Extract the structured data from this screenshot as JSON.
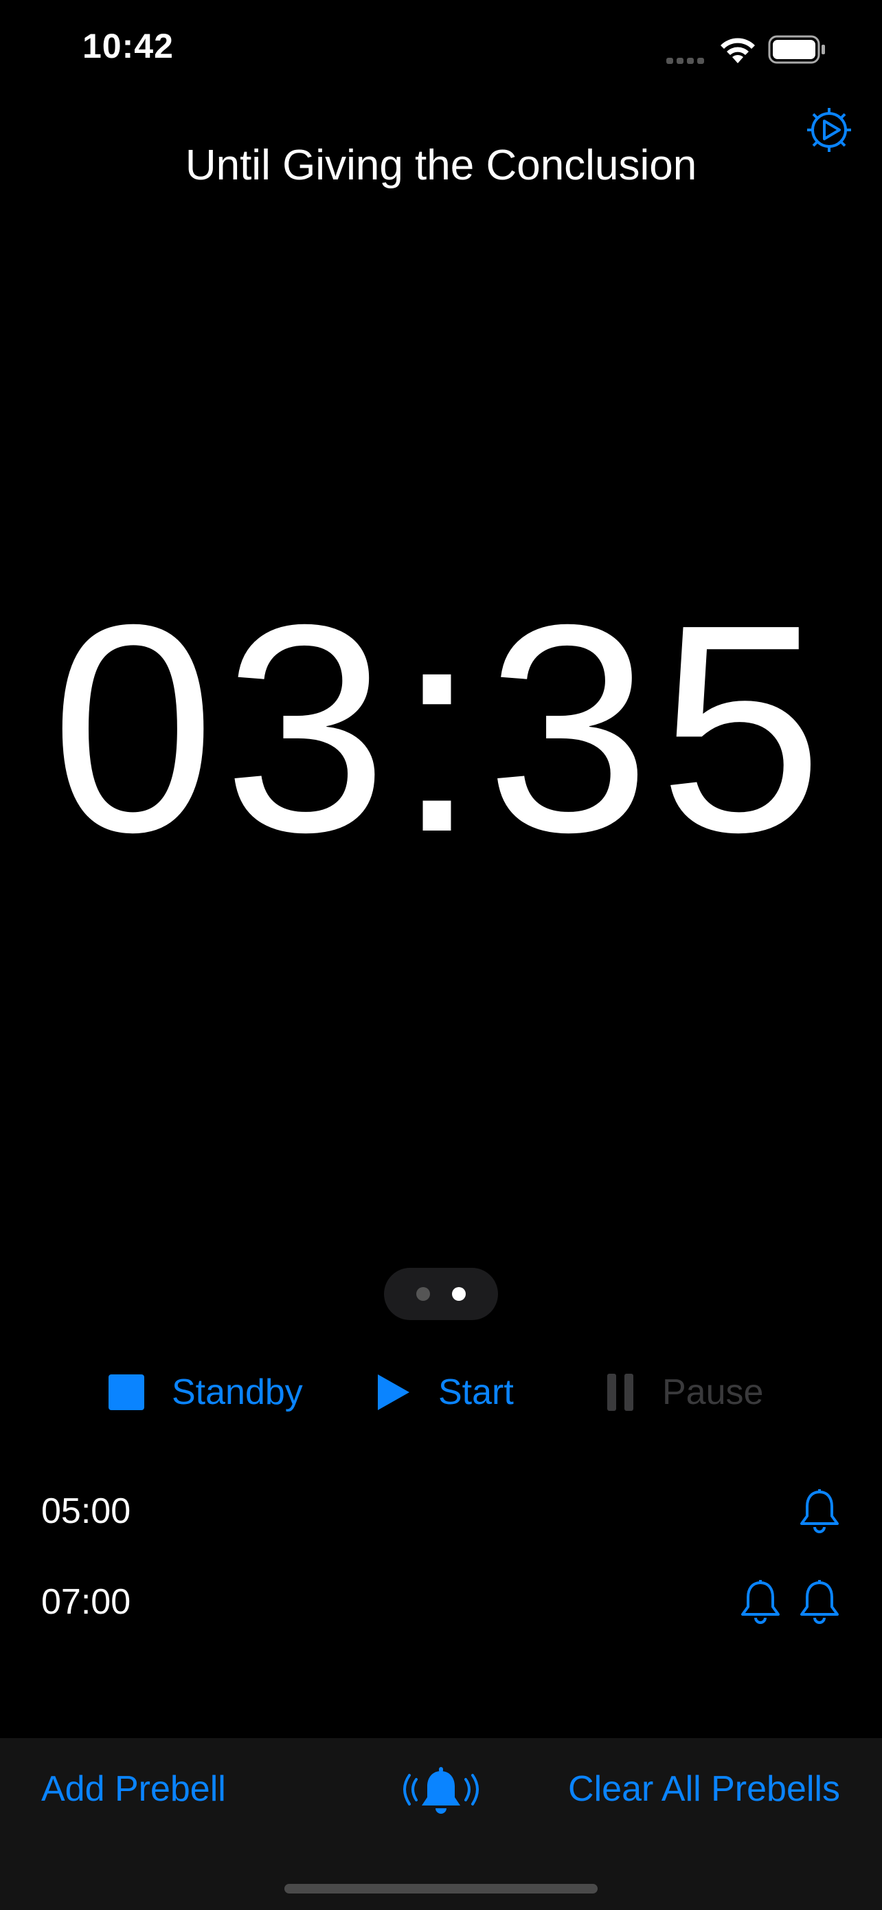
{
  "status_bar": {
    "time": "10:42"
  },
  "header": {
    "title": "Until Giving the Conclusion",
    "settings_icon": "gear-play-icon"
  },
  "timer": {
    "display": "03:35"
  },
  "page_indicator": {
    "pages": 2,
    "current": 2
  },
  "controls": {
    "standby_label": "Standby",
    "start_label": "Start",
    "pause_label": "Pause"
  },
  "prebells": [
    {
      "time": "05:00",
      "bell_count": 1
    },
    {
      "time": "07:00",
      "bell_count": 2
    }
  ],
  "toolbar": {
    "add_label": "Add Prebell",
    "ring_icon": "bell-ringing-icon",
    "clear_label": "Clear All Prebells"
  },
  "colors": {
    "accent": "#0a84ff",
    "background": "#000000",
    "disabled": "#3a3a3c",
    "toolbar_bg": "#141414"
  }
}
